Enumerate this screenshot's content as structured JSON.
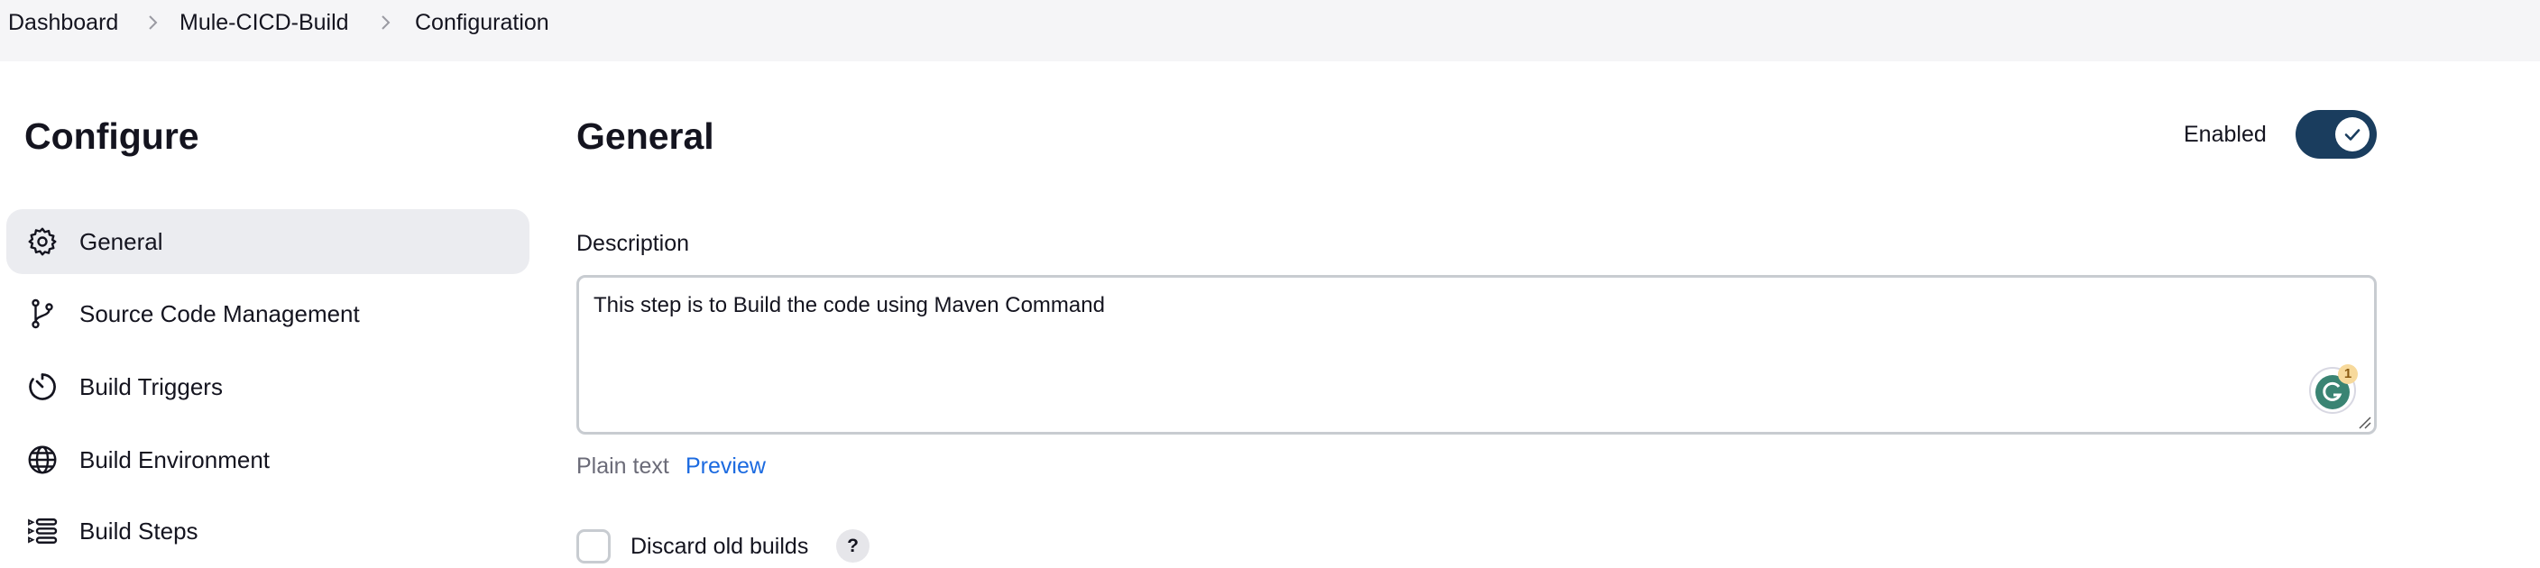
{
  "breadcrumbs": [
    "Dashboard",
    "Mule-CICD-Build",
    "Configuration"
  ],
  "sidebar": {
    "title": "Configure",
    "items": [
      {
        "label": "General",
        "icon": "gear-icon",
        "active": true
      },
      {
        "label": "Source Code Management",
        "icon": "git-branch-icon"
      },
      {
        "label": "Build Triggers",
        "icon": "timer-icon"
      },
      {
        "label": "Build Environment",
        "icon": "globe-icon"
      },
      {
        "label": "Build Steps",
        "icon": "list-steps-icon"
      }
    ]
  },
  "main": {
    "title": "General",
    "enabled_label": "Enabled",
    "enabled": true,
    "description_label": "Description",
    "description_value": "This step is to Build the code using Maven Command",
    "grammarly_badge": "1",
    "plain_text_label": "Plain text",
    "preview_link": "Preview",
    "discard_old_builds_label": "Discard old builds",
    "help_label": "?"
  },
  "colors": {
    "toggle": "#1a3d5e",
    "link": "#1b6ae0",
    "grammarly": "#3a8473"
  }
}
